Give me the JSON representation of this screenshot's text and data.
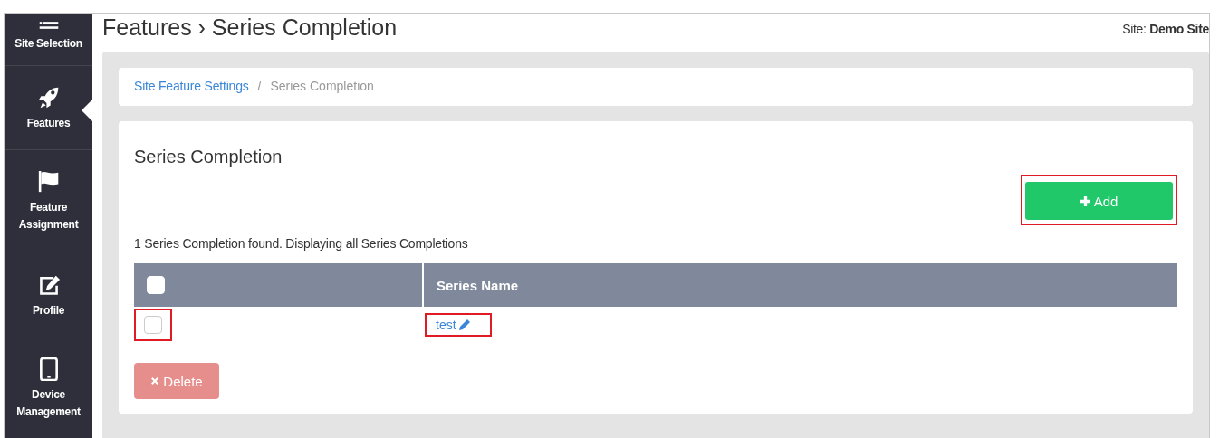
{
  "sidebar": {
    "items": [
      {
        "label": "Site Selection",
        "selected": false
      },
      {
        "label": "Features",
        "selected": true
      },
      {
        "label": "Feature Assignment",
        "selected": false
      },
      {
        "label": "Profile",
        "selected": false
      },
      {
        "label": "Device Management",
        "selected": false
      }
    ]
  },
  "header": {
    "title": "Features › Series Completion",
    "site": "Site: **Demo Site**"
  },
  "breadcrumb": [
    {
      "label": "Site Feature Settings",
      "link": true
    },
    {
      "label": "/",
      "link": false
    },
    {
      "label": "Series Completion",
      "link": false
    }
  ],
  "card": {
    "title": "Series Completion",
    "add_button": {
      "label": "Add",
      "highlighted": true
    },
    "summary": "1 Series Completion found. Displaying all Series Completions",
    "table": {
      "columns": [
        {
          "kind": "checkbox",
          "checked": false
        },
        {
          "kind": "text",
          "label": "Series Name"
        }
      ],
      "rows": [
        {
          "checked": false,
          "checkbox_highlighted": true,
          "name": "test",
          "name_highlighted": true
        }
      ]
    },
    "delete_button": {
      "label": "Delete",
      "disabled": true
    }
  }
}
